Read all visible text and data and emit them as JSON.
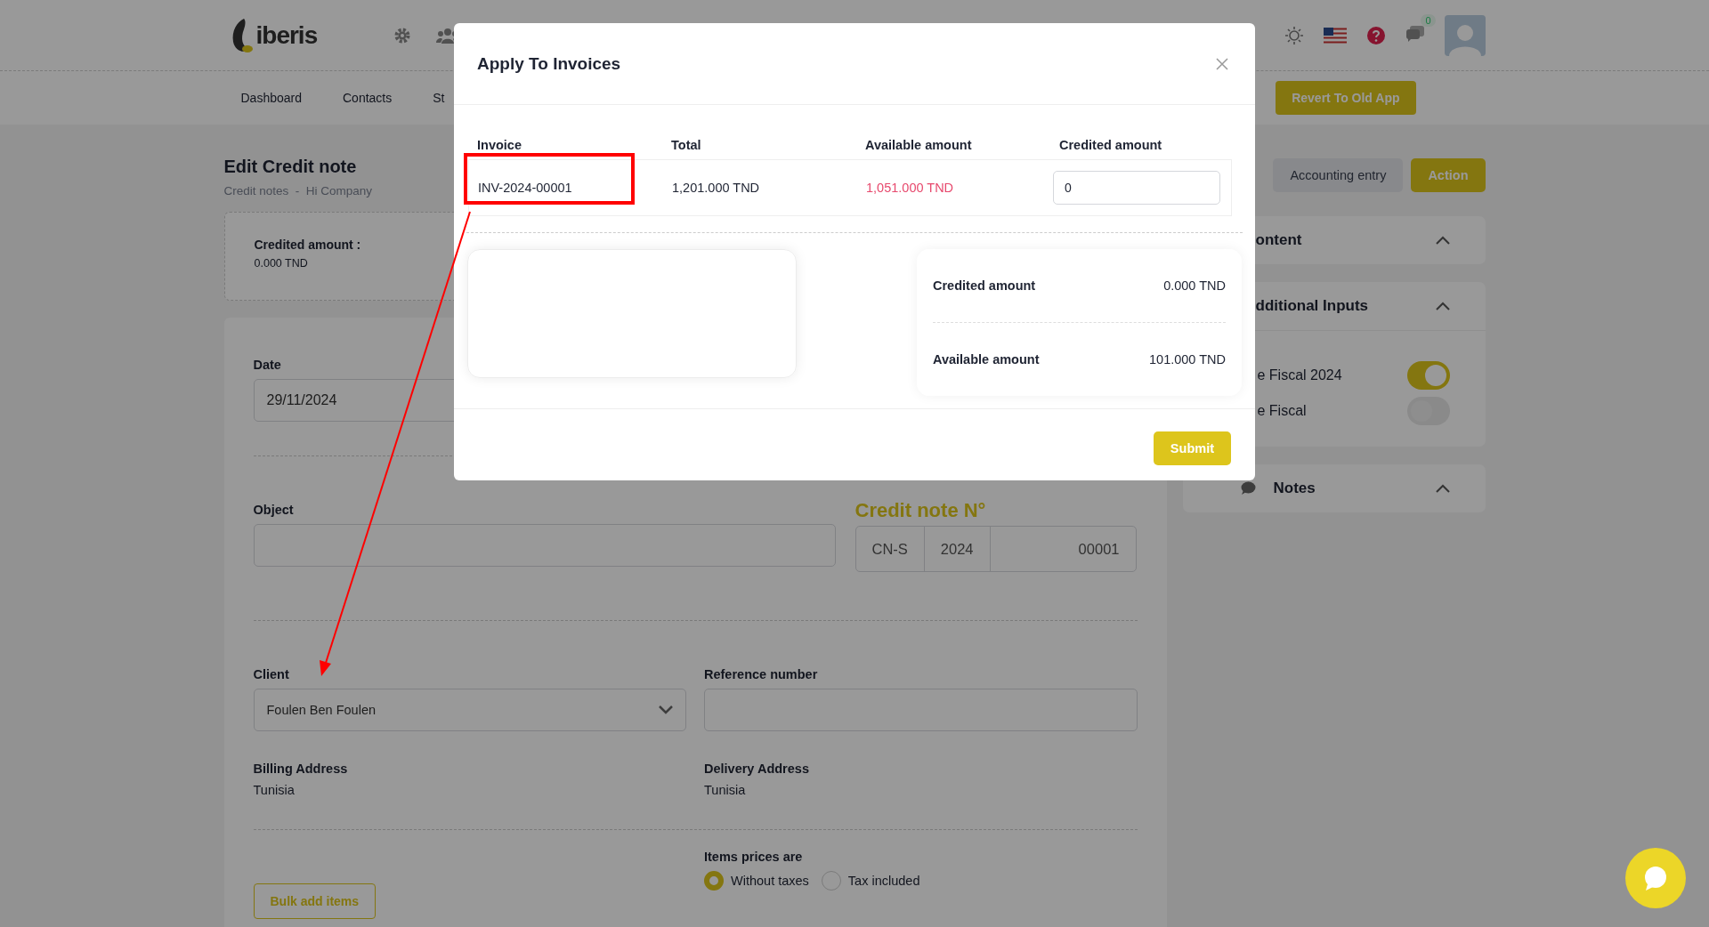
{
  "header": {
    "logo": "iberis",
    "chat_badge": "0"
  },
  "nav": {
    "items": [
      "Dashboard",
      "Contacts",
      "St"
    ],
    "revert_button": "Revert To Old App"
  },
  "page": {
    "title": "Edit Credit note",
    "breadcrumb": [
      "Credit notes",
      "Hi Company"
    ],
    "breadcrumb_separator": "-"
  },
  "credited_summary": {
    "label": "Credited amount :",
    "value": "0.000 TND"
  },
  "form": {
    "date": {
      "label": "Date",
      "value": "29/11/2024"
    },
    "object": {
      "label": "Object"
    },
    "credit_note_number": {
      "label": "Credit note N°",
      "segments": [
        "CN-S",
        "2024",
        "00001"
      ]
    },
    "client": {
      "label": "Client",
      "value": "Foulen Ben Foulen"
    },
    "reference_number": {
      "label": "Reference number"
    },
    "billing_address": {
      "label": "Billing Address",
      "value": "Tunisia"
    },
    "delivery_address": {
      "label": "Delivery Address",
      "value": "Tunisia"
    },
    "bulk_add_button": "Bulk add items",
    "prices": {
      "label": "Items prices are",
      "options": [
        {
          "label": "Without taxes",
          "selected": true
        },
        {
          "label": "Tax included",
          "selected": false
        }
      ]
    }
  },
  "actions": [
    {
      "label": "Accounting entry",
      "kind": "secondary"
    },
    {
      "label": "Action",
      "kind": "primary"
    }
  ],
  "sidebar": {
    "content_card": {
      "title": "ontent"
    },
    "additional_inputs": {
      "title": "dditional Inputs",
      "toggles": [
        {
          "label": "e Fiscal 2024",
          "on": true
        },
        {
          "label": "e Fiscal",
          "on": false
        }
      ]
    },
    "notes_card": {
      "title": "Notes"
    }
  },
  "modal": {
    "title": "Apply To Invoices",
    "columns": [
      "Invoice",
      "Total",
      "Available amount",
      "Credited amount"
    ],
    "rows": [
      {
        "invoice": "INV-2024-00001",
        "total": "1,201.000 TND",
        "available": "1,051.000 TND",
        "credited": "0"
      }
    ],
    "summary": [
      {
        "label": "Credited amount",
        "value": "0.000 TND"
      },
      {
        "label": "Available amount",
        "value": "101.000 TND"
      }
    ],
    "submit": "Submit"
  }
}
